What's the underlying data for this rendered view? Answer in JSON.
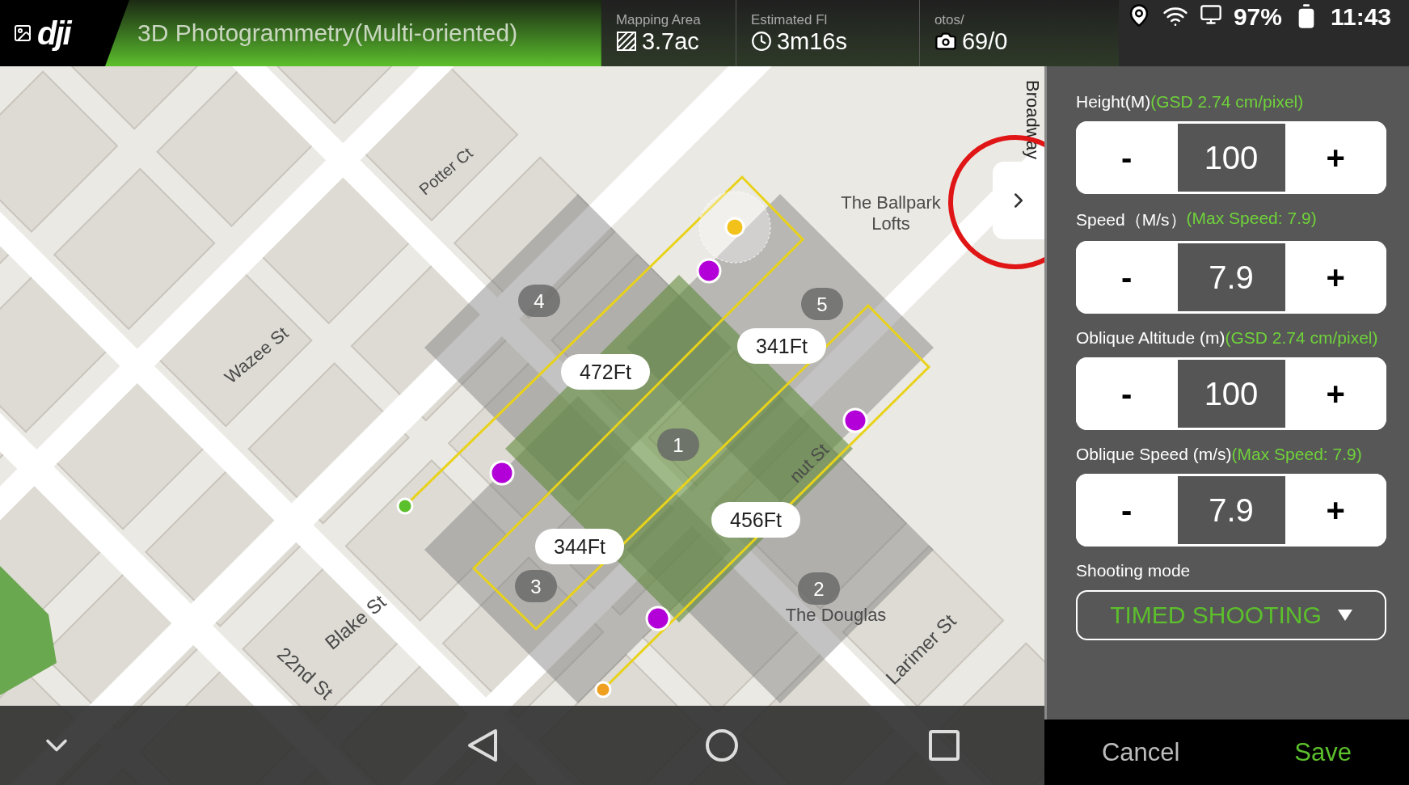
{
  "app_bar": {
    "logo": "dji",
    "title": "3D Photogrammetry(Multi-oriented)",
    "stats": [
      {
        "kind": "area",
        "label": "Mapping Area",
        "value": "3.7ac"
      },
      {
        "kind": "time",
        "label": "Estimated Fl",
        "value": "3m16s"
      },
      {
        "kind": "photos",
        "label": "otos/",
        "value": "69/0"
      }
    ]
  },
  "status_bar": {
    "battery": "97%",
    "time": "11:43"
  },
  "map": {
    "labels": [
      {
        "text": "Potter Ct"
      },
      {
        "text": "Wazee St"
      },
      {
        "text": "Blake St"
      },
      {
        "text": "22nd St"
      },
      {
        "text": "Larimer St"
      },
      {
        "text": "nut St"
      },
      {
        "text": "The Ballpark"
      },
      {
        "text": "Lofts"
      },
      {
        "text": "The Douglas"
      },
      {
        "text": "Broadway"
      }
    ],
    "area_numbers": [
      "4",
      "5",
      "1",
      "3",
      "2"
    ],
    "distances": [
      "472Ft",
      "341Ft",
      "344Ft",
      "456Ft"
    ]
  },
  "panel": {
    "fields": [
      {
        "label": "Height(M)",
        "hint": "(GSD 2.74 cm/pixel)",
        "decrement": "-",
        "value": "100",
        "increment": "+"
      },
      {
        "label": "Speed（M/s）",
        "hint": "(Max Speed: 7.9)",
        "decrement": "-",
        "value": "7.9",
        "increment": "+"
      },
      {
        "label": "Oblique Altitude (m)",
        "hint": "(GSD 2.74 cm/pixel)",
        "decrement": "-",
        "value": "100",
        "increment": "+"
      },
      {
        "label": "Oblique Speed (m/s)",
        "hint": "(Max Speed: 7.9)",
        "decrement": "-",
        "value": "7.9",
        "increment": "+"
      }
    ],
    "shooting_mode": {
      "label": "Shooting mode",
      "value": "TIMED SHOOTING"
    },
    "buttons": [
      {
        "kind": "cancel",
        "label": "Cancel"
      },
      {
        "kind": "save",
        "label": "Save"
      }
    ]
  }
}
